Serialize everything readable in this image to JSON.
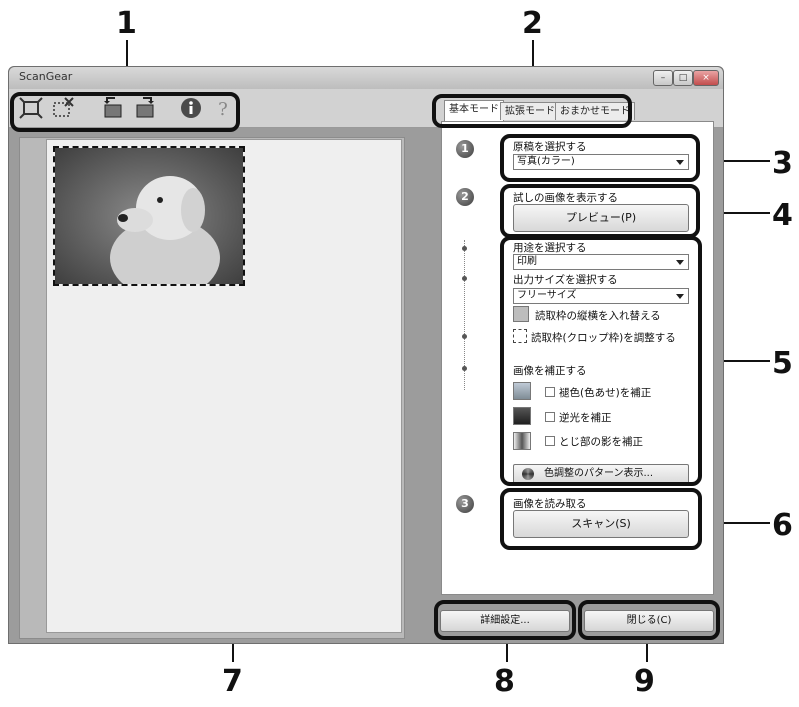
{
  "callouts": [
    "1",
    "2",
    "3",
    "4",
    "5",
    "6",
    "7",
    "8",
    "9"
  ],
  "window": {
    "title": "ScanGear"
  },
  "tabs": [
    "基本モード",
    "拡張モード",
    "おまかせモード"
  ],
  "steps": {
    "s1": {
      "num": "1",
      "label": "原稿を選択する",
      "value": "写真(カラー)"
    },
    "s2": {
      "num": "2",
      "label": "試しの画像を表示する",
      "button": "プレビュー(P)"
    },
    "purpose": {
      "label": "用途を選択する",
      "value": "印刷"
    },
    "output": {
      "label": "出力サイズを選択する",
      "value": "フリーサイズ"
    },
    "swap": "読取枠の縦横を入れ替える",
    "crop": "読取枠(クロップ枠)を調整する",
    "correct": {
      "label": "画像を補正する",
      "options": [
        "褪色(色あせ)を補正",
        "逆光を補正",
        "とじ部の影を補正"
      ],
      "pattern_button": "色調整のパターン表示..."
    },
    "s3": {
      "num": "3",
      "label": "画像を読み取る",
      "button": "スキャン(S)"
    }
  },
  "bottom": {
    "details": "詳細設定...",
    "close": "閉じる(C)"
  },
  "colors": {
    "window_gray": "#9c9c9c",
    "panel": "#ffffff",
    "highlight": "#111111"
  }
}
